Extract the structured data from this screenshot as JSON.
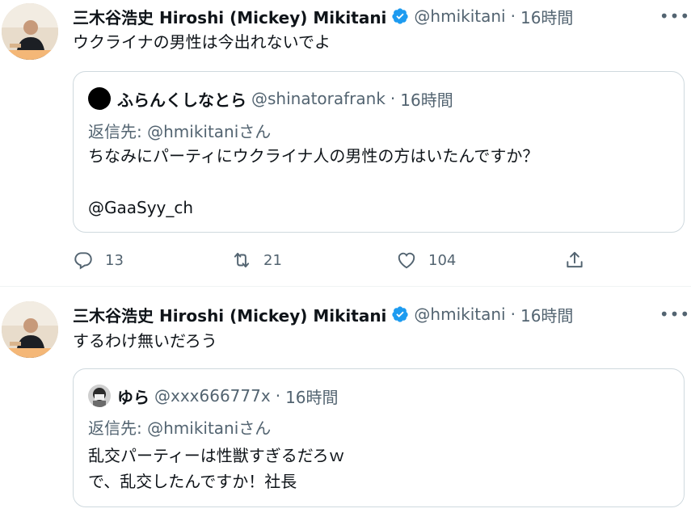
{
  "tweets": [
    {
      "author": {
        "name": "三木谷浩史 Hiroshi (Mickey) Mikitani",
        "handle": "@hmikitani",
        "time": "16時間",
        "verified": true
      },
      "text": "ウクライナの男性は今出れないでよ",
      "quote": {
        "author_name": "ふらんくしなとら",
        "author_handle": "@shinatorafrank",
        "time": "16時間",
        "reply_prefix": "返信先: ",
        "reply_to": "@hmikitaniさん",
        "text": "ちなみにパーティにウクライナ人の男性の方はいたんですか？\n\n@GaaSyy_ch"
      },
      "actions": {
        "replies": "13",
        "retweets": "21",
        "likes": "104"
      }
    },
    {
      "author": {
        "name": "三木谷浩史 Hiroshi (Mickey) Mikitani",
        "handle": "@hmikitani",
        "time": "16時間",
        "verified": true
      },
      "text": "するわけ無いだろう",
      "quote": {
        "author_name": "ゆら",
        "author_handle": "@xxx666777x",
        "time": "16時間",
        "reply_prefix": "返信先: ",
        "reply_to": "@hmikitaniさん",
        "text": "乱交パーティーは性獣すぎるだろｗ\nで、乱交したんですか！社長"
      }
    }
  ],
  "separator": "·",
  "more_glyph": "•••",
  "colors": {
    "verified": "#1d9bf0",
    "secondary_text": "#536471",
    "border": "#cfd9de"
  }
}
